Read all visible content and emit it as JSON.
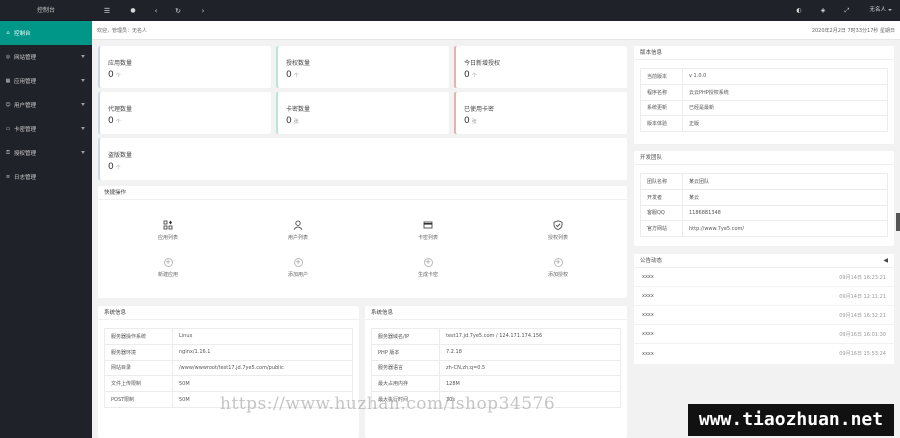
{
  "sidebar": {
    "logo": "控制台",
    "items": [
      {
        "label": "控制台",
        "icon": "home-icon"
      },
      {
        "label": "网站管理",
        "icon": "globe-icon"
      },
      {
        "label": "应用管理",
        "icon": "app-icon"
      },
      {
        "label": "用户管理",
        "icon": "user-icon"
      },
      {
        "label": "卡密管理",
        "icon": "card-icon"
      },
      {
        "label": "授权管理",
        "icon": "key-icon"
      },
      {
        "label": "日志管理",
        "icon": "log-icon"
      }
    ]
  },
  "topbar": {
    "user": "无名人"
  },
  "breadcrumb": {
    "welcome": "欢迎，管理员：无名人",
    "date": "2020年2月2日 7时33分17秒 星期日"
  },
  "stats": [
    {
      "label": "应用数量",
      "value": "0",
      "unit": "个"
    },
    {
      "label": "授权数量",
      "value": "0",
      "unit": "个"
    },
    {
      "label": "今日新增授权",
      "value": "0",
      "unit": "个"
    },
    {
      "label": "代理数量",
      "value": "0",
      "unit": "个"
    },
    {
      "label": "卡密数量",
      "value": "0",
      "unit": "张"
    },
    {
      "label": "已使用卡密",
      "value": "0",
      "unit": "张"
    },
    {
      "label": "盗版数量",
      "value": "0",
      "unit": "个"
    }
  ],
  "quick": {
    "title": "快捷操作",
    "items": [
      "应用列表",
      "用户列表",
      "卡密列表",
      "授权列表",
      "新建应用",
      "添加用户",
      "生成卡密",
      "添加授权"
    ]
  },
  "sysinfo1": {
    "title": "系统信息",
    "rows": [
      [
        "服务器操作系统",
        "Linux"
      ],
      [
        "服务器环境",
        "nginx/1.16.1"
      ],
      [
        "网站目录",
        "/www/wwwroot/test17.jd.7ye5.com/public"
      ],
      [
        "文件上传限制",
        "50M"
      ],
      [
        "POST限制",
        "50M"
      ]
    ]
  },
  "sysinfo2": {
    "title": "系统信息",
    "rows": [
      [
        "服务器域名/IP",
        "test17.jd.7ye5.com / 124.171.174.156"
      ],
      [
        "PHP 版本",
        "7.2.18"
      ],
      [
        "服务器语言",
        "zh-CN,zh;q=0.5"
      ],
      [
        "最大占用内存",
        "128M"
      ],
      [
        "最大执行时间",
        "30s"
      ]
    ]
  },
  "version": {
    "title": "版本信息",
    "rows": [
      [
        "当前版本",
        "v 1.0.0"
      ],
      [
        "程序名称",
        "云云PHP授权系统"
      ],
      [
        "系统更新",
        "已经是最新"
      ],
      [
        "版本体验",
        "正版"
      ]
    ]
  },
  "team": {
    "title": "开发团队",
    "rows": [
      [
        "团队名称",
        "某云团队"
      ],
      [
        "开发者",
        "某云"
      ],
      [
        "客服QQ",
        "1186881348"
      ],
      [
        "官方网站",
        "http://www.7ye5.com/"
      ]
    ]
  },
  "notice": {
    "title": "公告动态",
    "items": [
      [
        "xxxx",
        "09月14日 16:23:21"
      ],
      [
        "xxxx",
        "09月14日 12:11:21"
      ],
      [
        "xxxx",
        "09月14日 16:32:21"
      ],
      [
        "xxxx",
        "09月16日 16:01:30"
      ],
      [
        "xxxx",
        "09月16日 15:53:24"
      ]
    ]
  },
  "watermarks": {
    "left": "https://www.huzhan.com/ishop34576",
    "right": "www.tiaozhuan.net"
  }
}
